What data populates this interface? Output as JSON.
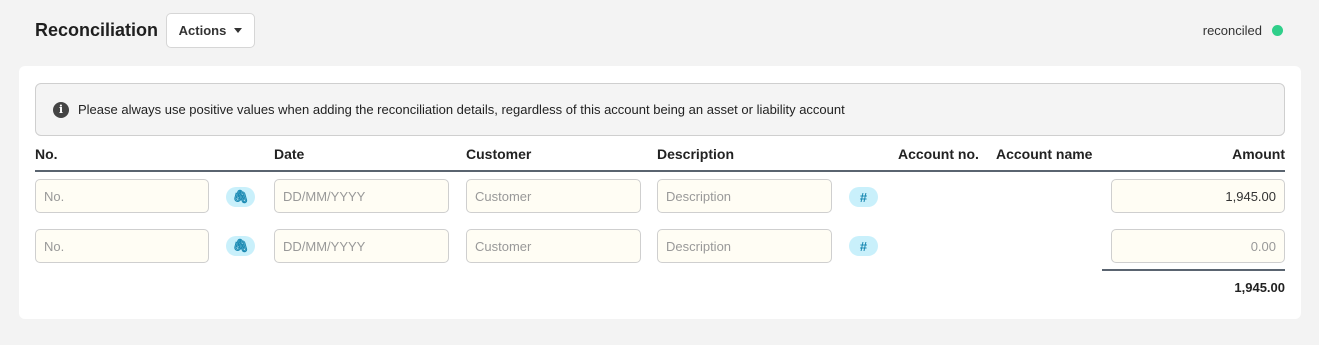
{
  "header": {
    "title": "Reconciliation",
    "actions_label": "Actions",
    "status_label": "reconciled",
    "status_color": "#2fcf8a"
  },
  "info": {
    "icon": "info-icon",
    "text": "Please always use positive values when adding the reconciliation details, regardless of this account being an asset or liability account"
  },
  "table": {
    "columns": {
      "no": "No.",
      "date": "Date",
      "customer": "Customer",
      "description": "Description",
      "account_no": "Account no.",
      "account_name": "Account name",
      "amount": "Amount"
    },
    "rows": [
      {
        "no_placeholder": "No.",
        "date_placeholder": "DD/MM/YYYY",
        "customer_placeholder": "Customer",
        "description_placeholder": "Description",
        "amount_value": "1,945.00"
      },
      {
        "no_placeholder": "No.",
        "date_placeholder": "DD/MM/YYYY",
        "customer_placeholder": "Customer",
        "description_placeholder": "Description",
        "amount_value": "0.00"
      }
    ],
    "total": "1,945.00"
  }
}
